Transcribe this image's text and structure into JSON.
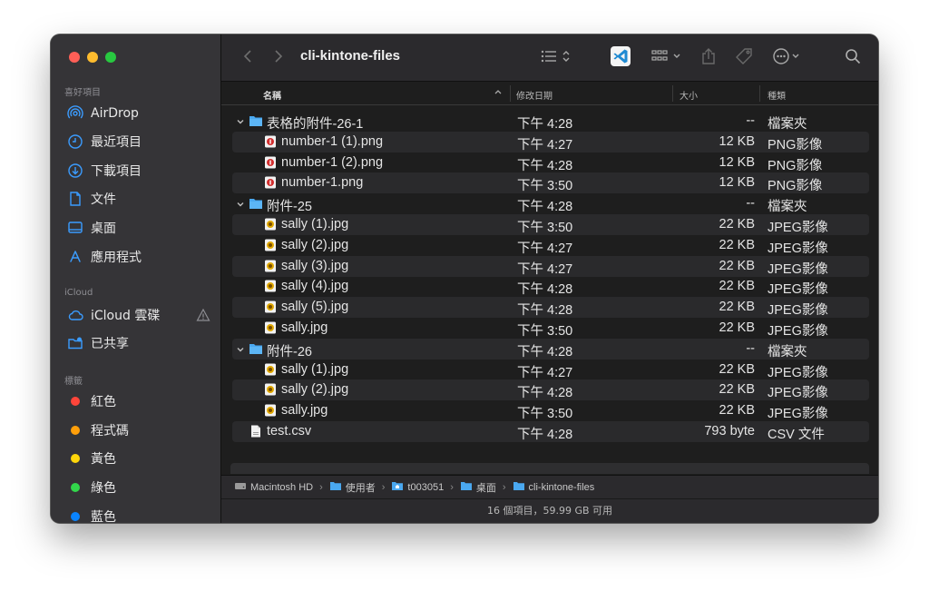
{
  "sidebar": {
    "favorites_label": "喜好項目",
    "favorites": [
      {
        "label": "AirDrop",
        "icon": "airdrop-icon"
      },
      {
        "label": "最近項目",
        "icon": "clock-icon"
      },
      {
        "label": "下載項目",
        "icon": "download-icon"
      },
      {
        "label": "文件",
        "icon": "document-icon"
      },
      {
        "label": "桌面",
        "icon": "desktop-icon"
      },
      {
        "label": "應用程式",
        "icon": "applications-icon"
      }
    ],
    "icloud_label": "iCloud",
    "icloud": [
      {
        "label": "iCloud 雲碟",
        "icon": "cloud-icon"
      },
      {
        "label": "已共享",
        "icon": "shared-folder-icon"
      }
    ],
    "tags_label": "標籤",
    "tags": [
      {
        "label": "紅色",
        "color": "#ff453a"
      },
      {
        "label": "程式碼",
        "color": "#ff9f0a"
      },
      {
        "label": "黃色",
        "color": "#ffd60a"
      },
      {
        "label": "綠色",
        "color": "#32d74b"
      },
      {
        "label": "藍色",
        "color": "#0a84ff"
      }
    ]
  },
  "toolbar": {
    "title": "cli-kintone-files"
  },
  "columns": {
    "name": "名稱",
    "date": "修改日期",
    "size": "大小",
    "kind": "種類"
  },
  "rows": [
    {
      "name": "表格的附件-26-1",
      "date": "下午 4:28",
      "size": "--",
      "kind": "檔案夾",
      "level": 0,
      "type": "folder"
    },
    {
      "name": "number-1 (1).png",
      "date": "下午 4:27",
      "size": "12 KB",
      "kind": "PNG影像",
      "level": 1,
      "type": "png"
    },
    {
      "name": "number-1 (2).png",
      "date": "下午 4:28",
      "size": "12 KB",
      "kind": "PNG影像",
      "level": 1,
      "type": "png"
    },
    {
      "name": "number-1.png",
      "date": "下午 3:50",
      "size": "12 KB",
      "kind": "PNG影像",
      "level": 1,
      "type": "png"
    },
    {
      "name": "附件-25",
      "date": "下午 4:28",
      "size": "--",
      "kind": "檔案夾",
      "level": 0,
      "type": "folder"
    },
    {
      "name": "sally (1).jpg",
      "date": "下午 3:50",
      "size": "22 KB",
      "kind": "JPEG影像",
      "level": 1,
      "type": "jpg"
    },
    {
      "name": "sally (2).jpg",
      "date": "下午 4:27",
      "size": "22 KB",
      "kind": "JPEG影像",
      "level": 1,
      "type": "jpg"
    },
    {
      "name": "sally (3).jpg",
      "date": "下午 4:27",
      "size": "22 KB",
      "kind": "JPEG影像",
      "level": 1,
      "type": "jpg"
    },
    {
      "name": "sally (4).jpg",
      "date": "下午 4:28",
      "size": "22 KB",
      "kind": "JPEG影像",
      "level": 1,
      "type": "jpg"
    },
    {
      "name": "sally (5).jpg",
      "date": "下午 4:28",
      "size": "22 KB",
      "kind": "JPEG影像",
      "level": 1,
      "type": "jpg"
    },
    {
      "name": "sally.jpg",
      "date": "下午 3:50",
      "size": "22 KB",
      "kind": "JPEG影像",
      "level": 1,
      "type": "jpg"
    },
    {
      "name": "附件-26",
      "date": "下午 4:28",
      "size": "--",
      "kind": "檔案夾",
      "level": 0,
      "type": "folder"
    },
    {
      "name": "sally (1).jpg",
      "date": "下午 4:27",
      "size": "22 KB",
      "kind": "JPEG影像",
      "level": 1,
      "type": "jpg"
    },
    {
      "name": "sally (2).jpg",
      "date": "下午 4:28",
      "size": "22 KB",
      "kind": "JPEG影像",
      "level": 1,
      "type": "jpg"
    },
    {
      "name": "sally.jpg",
      "date": "下午 3:50",
      "size": "22 KB",
      "kind": "JPEG影像",
      "level": 1,
      "type": "jpg"
    },
    {
      "name": "test.csv",
      "date": "下午 4:28",
      "size": "793 byte",
      "kind": "CSV 文件",
      "level": 0,
      "type": "csv"
    }
  ],
  "pathbar": [
    "Macintosh HD",
    "使用者",
    "t003051",
    "桌面",
    "cli-kintone-files"
  ],
  "status": "16 個項目，59.99 GB 可用"
}
